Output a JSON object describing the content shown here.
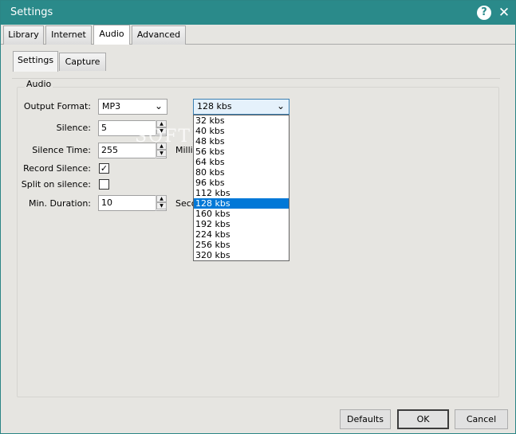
{
  "window": {
    "title": "Settings"
  },
  "main_tabs": [
    {
      "label": "Library"
    },
    {
      "label": "Internet"
    },
    {
      "label": "Audio"
    },
    {
      "label": "Advanced"
    }
  ],
  "sub_tabs": [
    {
      "label": "Settings"
    },
    {
      "label": "Capture"
    }
  ],
  "audio_group": {
    "title": "Audio",
    "output_format": {
      "label": "Output Format:",
      "value": "MP3"
    },
    "bitrate": {
      "value": "128 kbs"
    },
    "silence": {
      "label": "Silence:",
      "value": "5"
    },
    "silence_time": {
      "label": "Silence Time:",
      "value": "255",
      "unit": "Milli"
    },
    "record_silence": {
      "label": "Record Silence:",
      "checked": true
    },
    "split_on_silence": {
      "label": "Split on silence:",
      "checked": false
    },
    "min_duration": {
      "label": "Min. Duration:",
      "value": "10",
      "unit": "Seco"
    }
  },
  "bitrate_options": [
    "32 kbs",
    "40 kbs",
    "48 kbs",
    "56 kbs",
    "64 kbs",
    "80 kbs",
    "96 kbs",
    "112 kbs",
    "128 kbs",
    "160 kbs",
    "192 kbs",
    "224 kbs",
    "256 kbs",
    "320 kbs"
  ],
  "buttons": {
    "defaults": "Defaults",
    "ok": "OK",
    "cancel": "Cancel"
  },
  "watermark": "SOFTPEDIA",
  "colors": {
    "titlebar": "#2a8a8a",
    "selection": "#0078d7"
  }
}
